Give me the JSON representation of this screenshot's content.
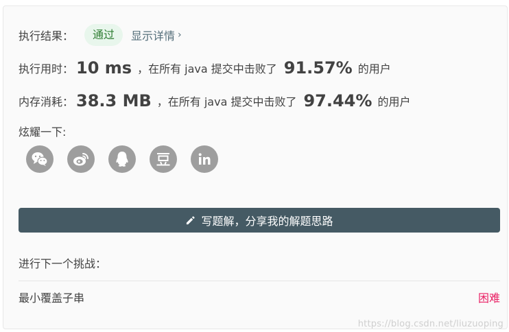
{
  "result": {
    "label": "执行结果：",
    "status": "通过",
    "details_link": "显示详情"
  },
  "runtime": {
    "label": "执行用时：",
    "value": "10 ms",
    "middle_text": "，在所有 java 提交中击败了",
    "percent": "91.57%",
    "suffix": "的用户"
  },
  "memory": {
    "label": "内存消耗：",
    "value": "38.3 MB",
    "middle_text": "，在所有 java 提交中击败了",
    "percent": "97.44%",
    "suffix": "的用户"
  },
  "share": {
    "label": "炫耀一下:",
    "items": [
      "wechat-icon",
      "weibo-icon",
      "qq-icon",
      "douban-icon",
      "linkedin-icon"
    ]
  },
  "write_solution": {
    "label": "写题解，分享我的解题思路"
  },
  "next_challenge": {
    "label": "进行下一个挑战：",
    "problem": "最小覆盖子串",
    "difficulty": "困难"
  },
  "watermark": "https://blog.csdn.net/liuzuoping",
  "colors": {
    "accent": "#455a64",
    "success_bg": "#e8f6ec",
    "success_text": "#2e7d32",
    "hard": "#e91e63",
    "icon_bg": "#9e9e9e"
  }
}
